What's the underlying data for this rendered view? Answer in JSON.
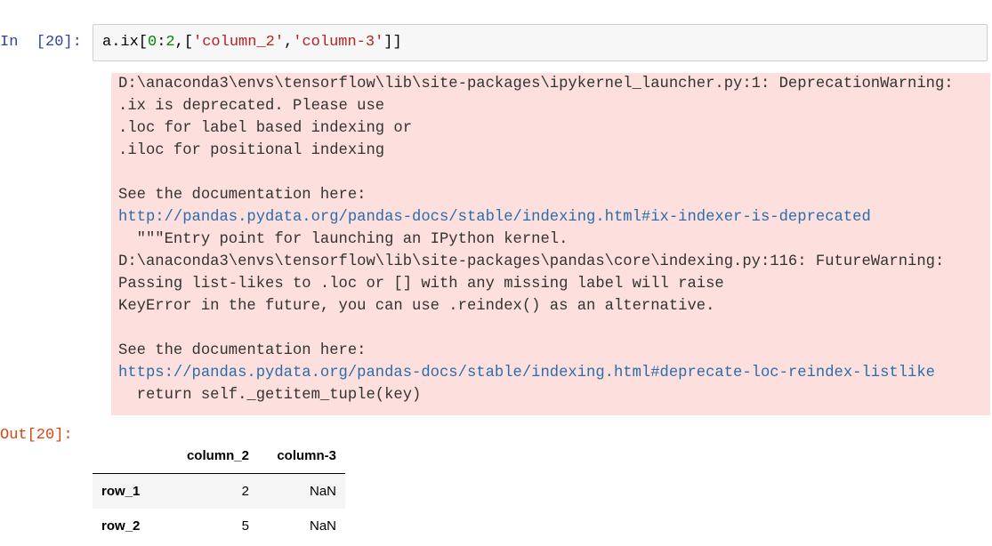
{
  "input_cell": {
    "prompt": "In  [20]:",
    "code_tokens": [
      {
        "text": "a.ix[",
        "kind": "var"
      },
      {
        "text": "0",
        "kind": "num"
      },
      {
        "text": ":",
        "kind": "punct"
      },
      {
        "text": "2",
        "kind": "num"
      },
      {
        "text": ",[",
        "kind": "punct"
      },
      {
        "text": "'column_2'",
        "kind": "str"
      },
      {
        "text": ",",
        "kind": "punct"
      },
      {
        "text": "'column-3'",
        "kind": "str"
      },
      {
        "text": "]]",
        "kind": "punct"
      }
    ]
  },
  "stderr": {
    "lines": [
      {
        "text": "D:\\anaconda3\\envs\\tensorflow\\lib\\site-packages\\ipykernel_launcher.py:1: DeprecationWarning:",
        "link": false
      },
      {
        "text": ".ix is deprecated. Please use",
        "link": false
      },
      {
        "text": ".loc for label based indexing or",
        "link": false
      },
      {
        "text": ".iloc for positional indexing",
        "link": false
      },
      {
        "text": "",
        "link": false
      },
      {
        "text": "See the documentation here:",
        "link": false
      },
      {
        "text": "http://pandas.pydata.org/pandas-docs/stable/indexing.html#ix-indexer-is-deprecated",
        "link": true
      },
      {
        "text": "  \"\"\"Entry point for launching an IPython kernel.",
        "link": false
      },
      {
        "text": "D:\\anaconda3\\envs\\tensorflow\\lib\\site-packages\\pandas\\core\\indexing.py:116: FutureWarning:",
        "link": false
      },
      {
        "text": "Passing list-likes to .loc or [] with any missing label will raise",
        "link": false
      },
      {
        "text": "KeyError in the future, you can use .reindex() as an alternative.",
        "link": false
      },
      {
        "text": "",
        "link": false
      },
      {
        "text": "See the documentation here:",
        "link": false
      },
      {
        "text": "https://pandas.pydata.org/pandas-docs/stable/indexing.html#deprecate-loc-reindex-listlike",
        "link": true
      },
      {
        "text": "  return self._getitem_tuple(key)",
        "link": false
      }
    ]
  },
  "output_cell": {
    "prompt": "Out[20]:",
    "table": {
      "columns": [
        "",
        "column_2",
        "column-3"
      ],
      "rows": [
        {
          "index": "row_1",
          "values": [
            "2",
            "NaN"
          ]
        },
        {
          "index": "row_2",
          "values": [
            "5",
            "NaN"
          ]
        }
      ]
    }
  }
}
